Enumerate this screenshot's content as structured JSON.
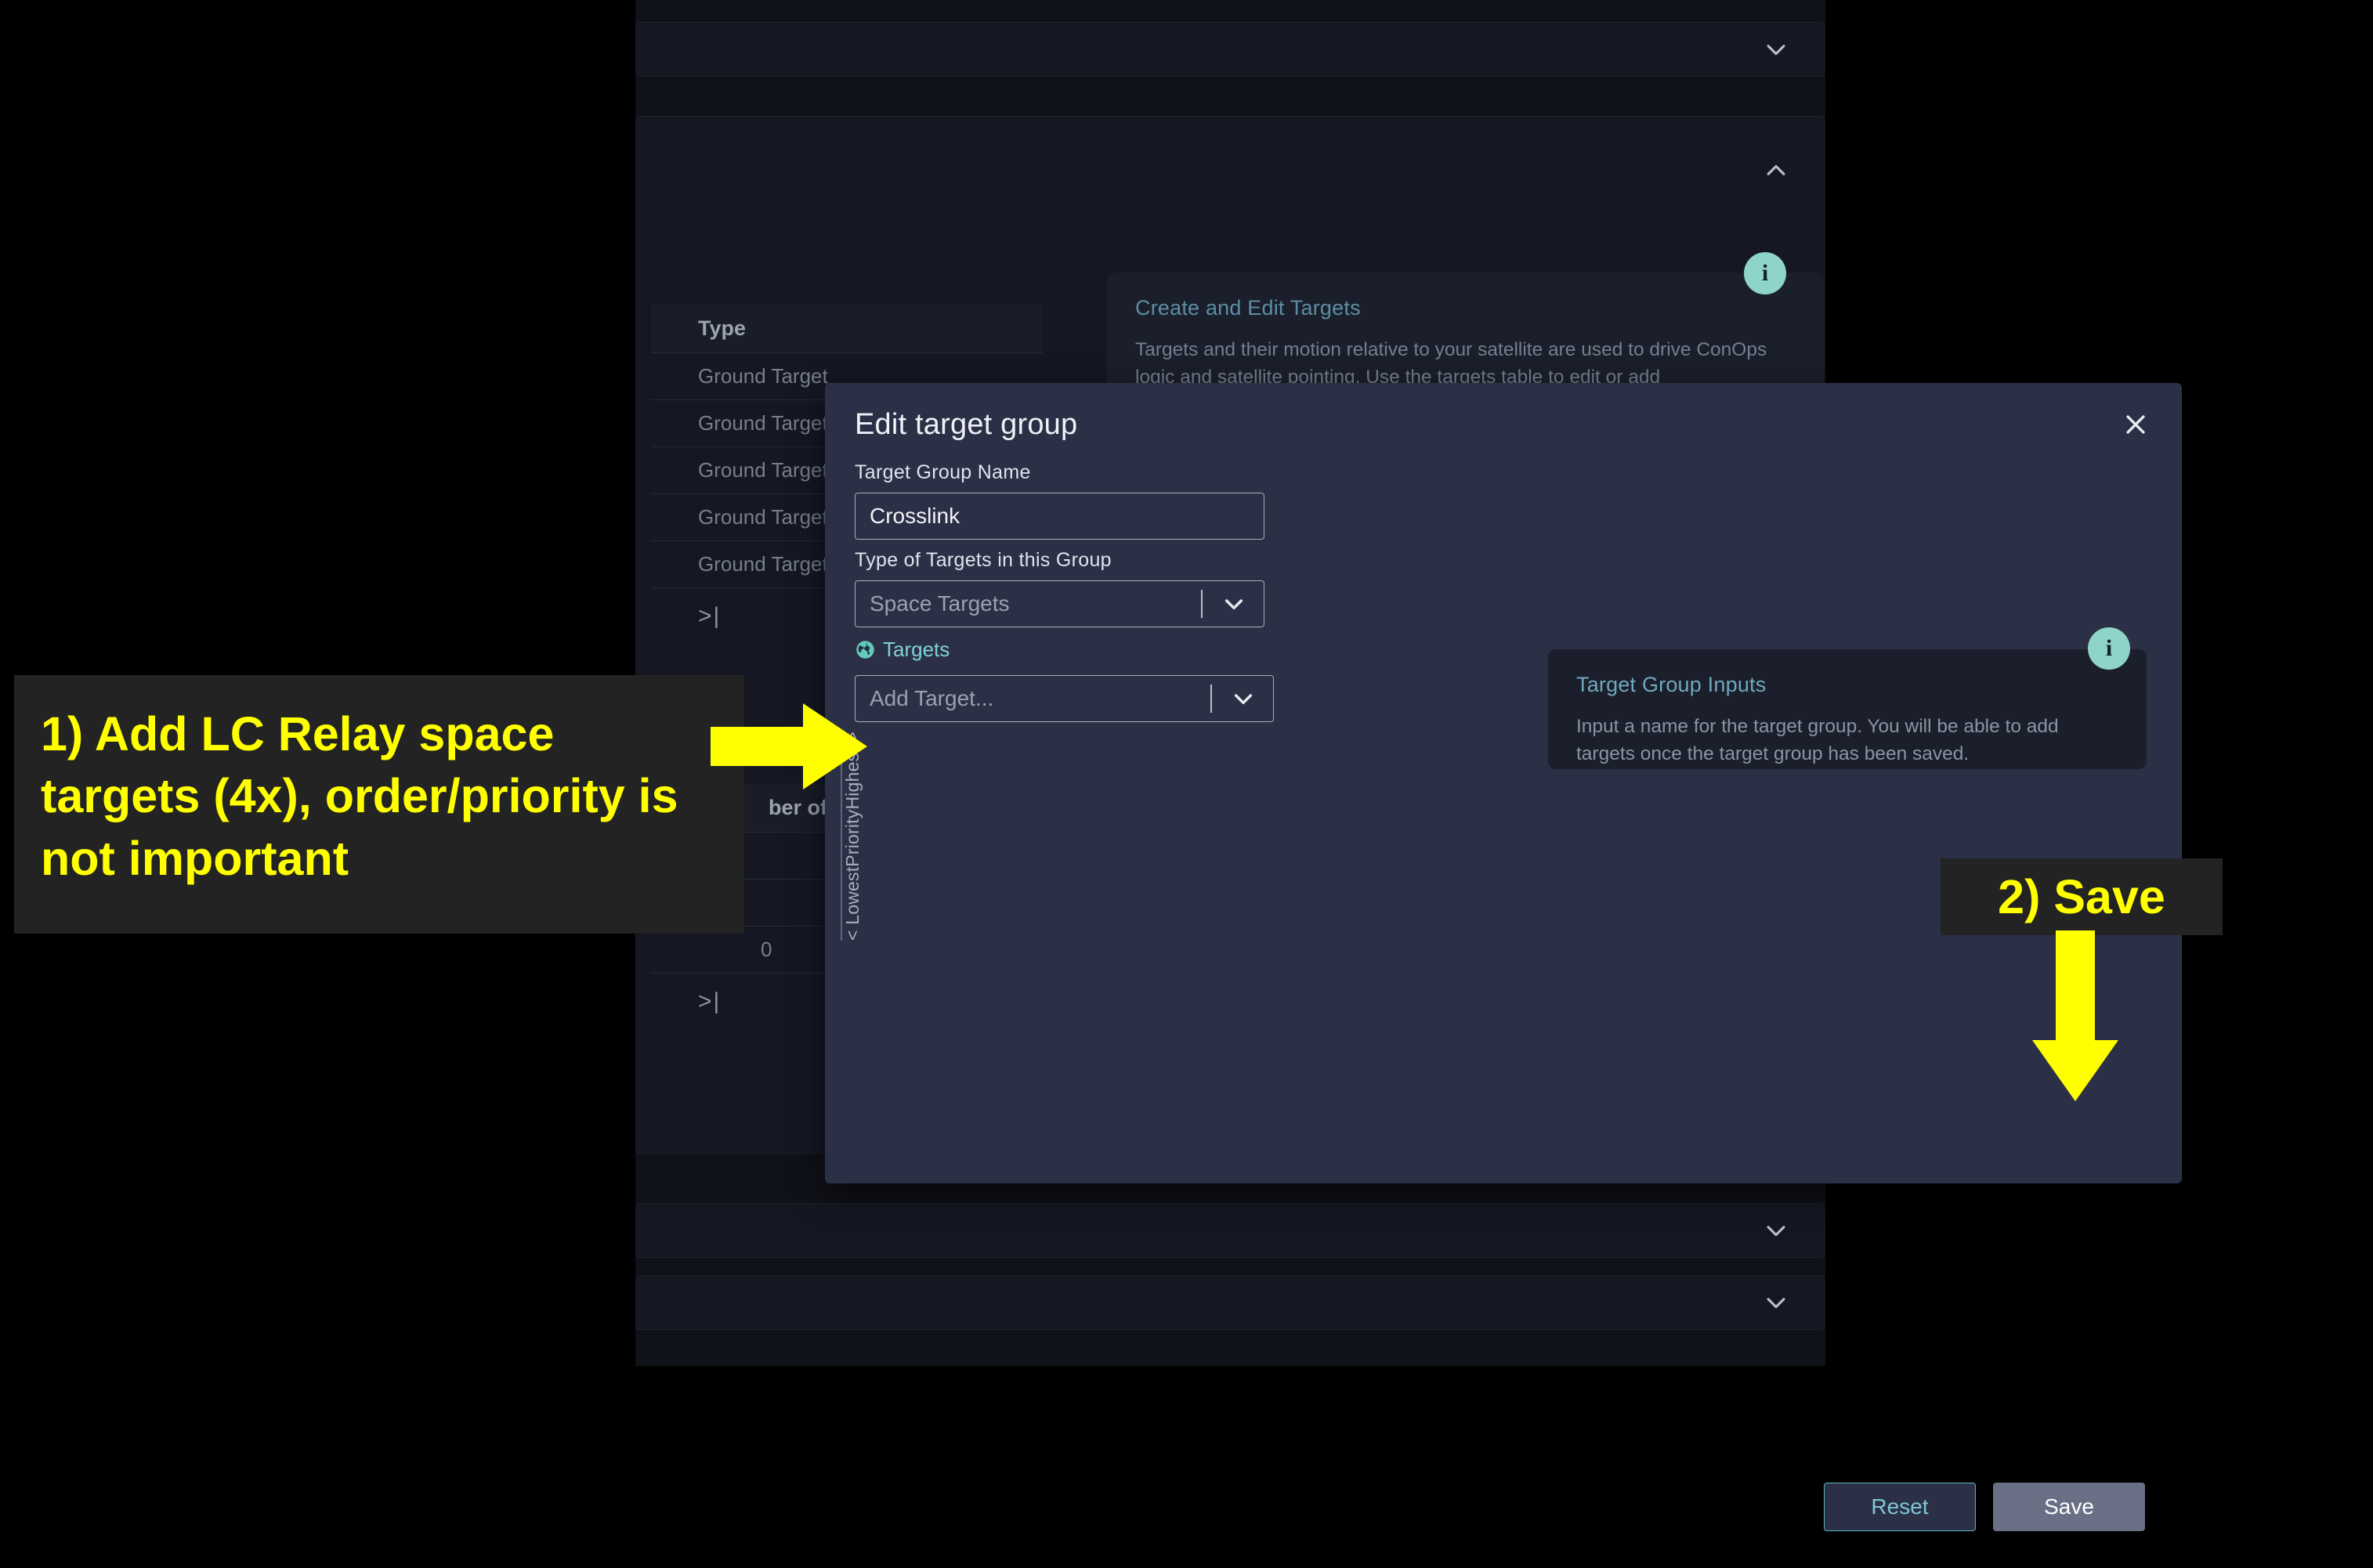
{
  "app": {
    "accordions": [
      {
        "name": "panel-collapsed-top",
        "label": "",
        "state": "collapsed",
        "icon": "chevron-down-icon"
      },
      {
        "name": "panel-targets",
        "label": "",
        "state": "expanded",
        "icon": "chevron-up-icon"
      },
      {
        "name": "panel-collapsed-lower-1",
        "label": "",
        "state": "collapsed",
        "icon": "chevron-down-icon"
      },
      {
        "name": "panel-collapsed-lower-2",
        "label": "",
        "state": "collapsed",
        "icon": "chevron-down-icon"
      }
    ],
    "info_card": {
      "title": "Create and Edit Targets",
      "body": "Targets and their motion relative to your satellite are used to drive ConOps logic and satellite pointing. Use the targets table to edit or add",
      "badge": "i"
    },
    "targets_table": {
      "column_header": "Type",
      "rows": [
        "Ground Target",
        "Ground Target",
        "Ground Target",
        "Ground Target",
        "Ground Target"
      ],
      "pager_icon": ">|"
    },
    "groups_table": {
      "column_header": "ber of Ta",
      "rows": [
        "",
        "",
        "0"
      ],
      "pager_icon": ">|"
    }
  },
  "dialog": {
    "title": "Edit target group",
    "close_icon": "close-icon",
    "name_label": "Target Group Name",
    "name_value": "Crosslink",
    "type_label": "Type of Targets in this Group",
    "type_value": "Space Targets",
    "targets_label": "Targets",
    "targets_icon": "globe-icon",
    "add_target_placeholder": "Add Target...",
    "priority_axis": {
      "low": "< Lowest",
      "middle": "Priority",
      "high": "Highest >"
    },
    "info_card": {
      "title": "Target Group Inputs",
      "body": "Input a name for the target group. You will be able to add targets once the target group has been saved.",
      "badge": "i"
    },
    "reset_label": "Reset",
    "save_label": "Save"
  },
  "annotations": {
    "step1": "1) Add LC Relay space targets (4x), order/priority is not important",
    "step2": "2) Save",
    "arrow_color": "#ffff00"
  },
  "colors": {
    "accent_teal": "#7fd3d8",
    "info_badge": "#8fd4c8",
    "annotation_yellow": "#ffff00",
    "dialog_bg": "#2b3046",
    "app_bg": "#101219"
  }
}
